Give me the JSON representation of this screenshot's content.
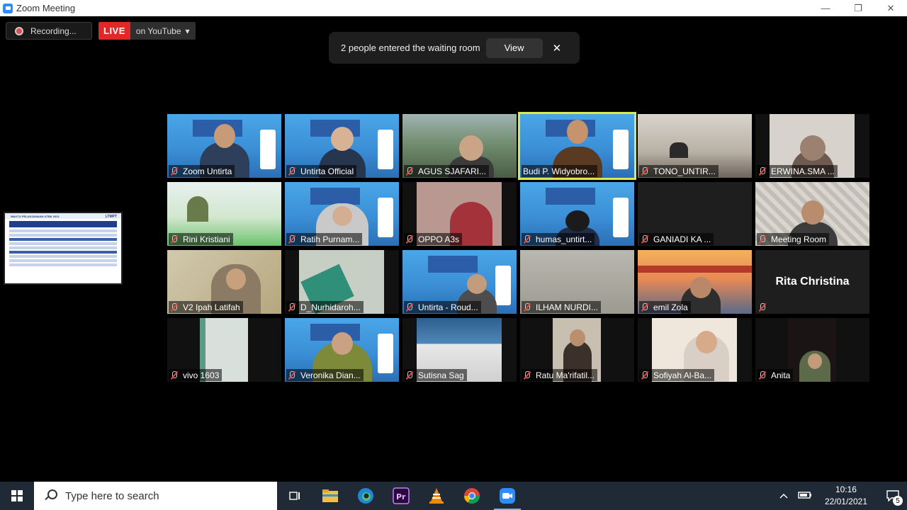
{
  "window": {
    "title": "Zoom Meeting",
    "minimize": "—",
    "restore": "❐",
    "close": "✕"
  },
  "recording": {
    "label": "Recording..."
  },
  "live": {
    "badge": "LIVE",
    "platform": "on YouTube",
    "caret": "▾"
  },
  "waiting_room": {
    "message": "2 people entered the waiting room",
    "view_label": "View",
    "close_label": "✕"
  },
  "participants": [
    {
      "name": "Zoom Untirta"
    },
    {
      "name": "Untirta Official"
    },
    {
      "name": "AGUS SJAFARI..."
    },
    {
      "name": "Budi P. Widyobro..."
    },
    {
      "name": "TONO_UNTIR..."
    },
    {
      "name": "ERWINA.SMA ..."
    },
    {
      "name": "Rini Kristiani"
    },
    {
      "name": "Ratih Purnam..."
    },
    {
      "name": "OPPO A3s"
    },
    {
      "name": "humas_untirt..."
    },
    {
      "name": "GANIADI  KA ..."
    },
    {
      "name": "Meeting Room"
    },
    {
      "name": "V2 Ipah Latifah"
    },
    {
      "name": "D_Nurhidaroh..."
    },
    {
      "name": "Untirta - Roud..."
    },
    {
      "name": "ILHAM NURDI..."
    },
    {
      "name": "emil Zola"
    },
    {
      "name": "Rita Christina"
    },
    {
      "name": "vivo 1603"
    },
    {
      "name": "Veronika Dian..."
    },
    {
      "name": "Sutisna Sag"
    },
    {
      "name": "Ratu Ma'rifatil..."
    },
    {
      "name": "Sofiyah Al-Ba..."
    },
    {
      "name": "Anita"
    }
  ],
  "shared_screen": {
    "title": "WAKTU PELAKSANAAN UTBK 2021",
    "logo": "LTMPT"
  },
  "taskbar": {
    "search_placeholder": "Type here to search",
    "time": "10:16",
    "date": "22/01/2021",
    "notification_count": "5"
  },
  "colors": {
    "accent": "#2d8cff",
    "live_red": "#e02828",
    "active_speaker": "#d8e94b"
  }
}
